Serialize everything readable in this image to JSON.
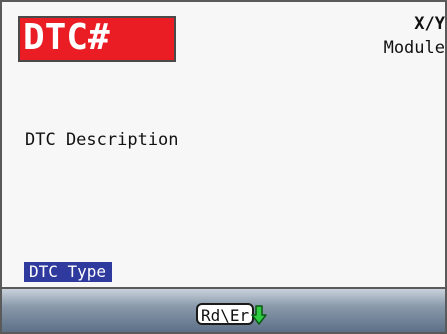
{
  "header": {
    "dtc_number": "DTC#",
    "position": "X/Y",
    "module": "Module"
  },
  "body": {
    "description": "DTC Description",
    "dtc_type": "DTC Type"
  },
  "softkeys": {
    "read_erase_label": "Rd\\Er",
    "scroll_icon": "down-arrow-icon"
  },
  "colors": {
    "dtc_box": "#ea1c24",
    "dtc_type_badge": "#2e3a9e",
    "arrow": "#2ecc40"
  }
}
